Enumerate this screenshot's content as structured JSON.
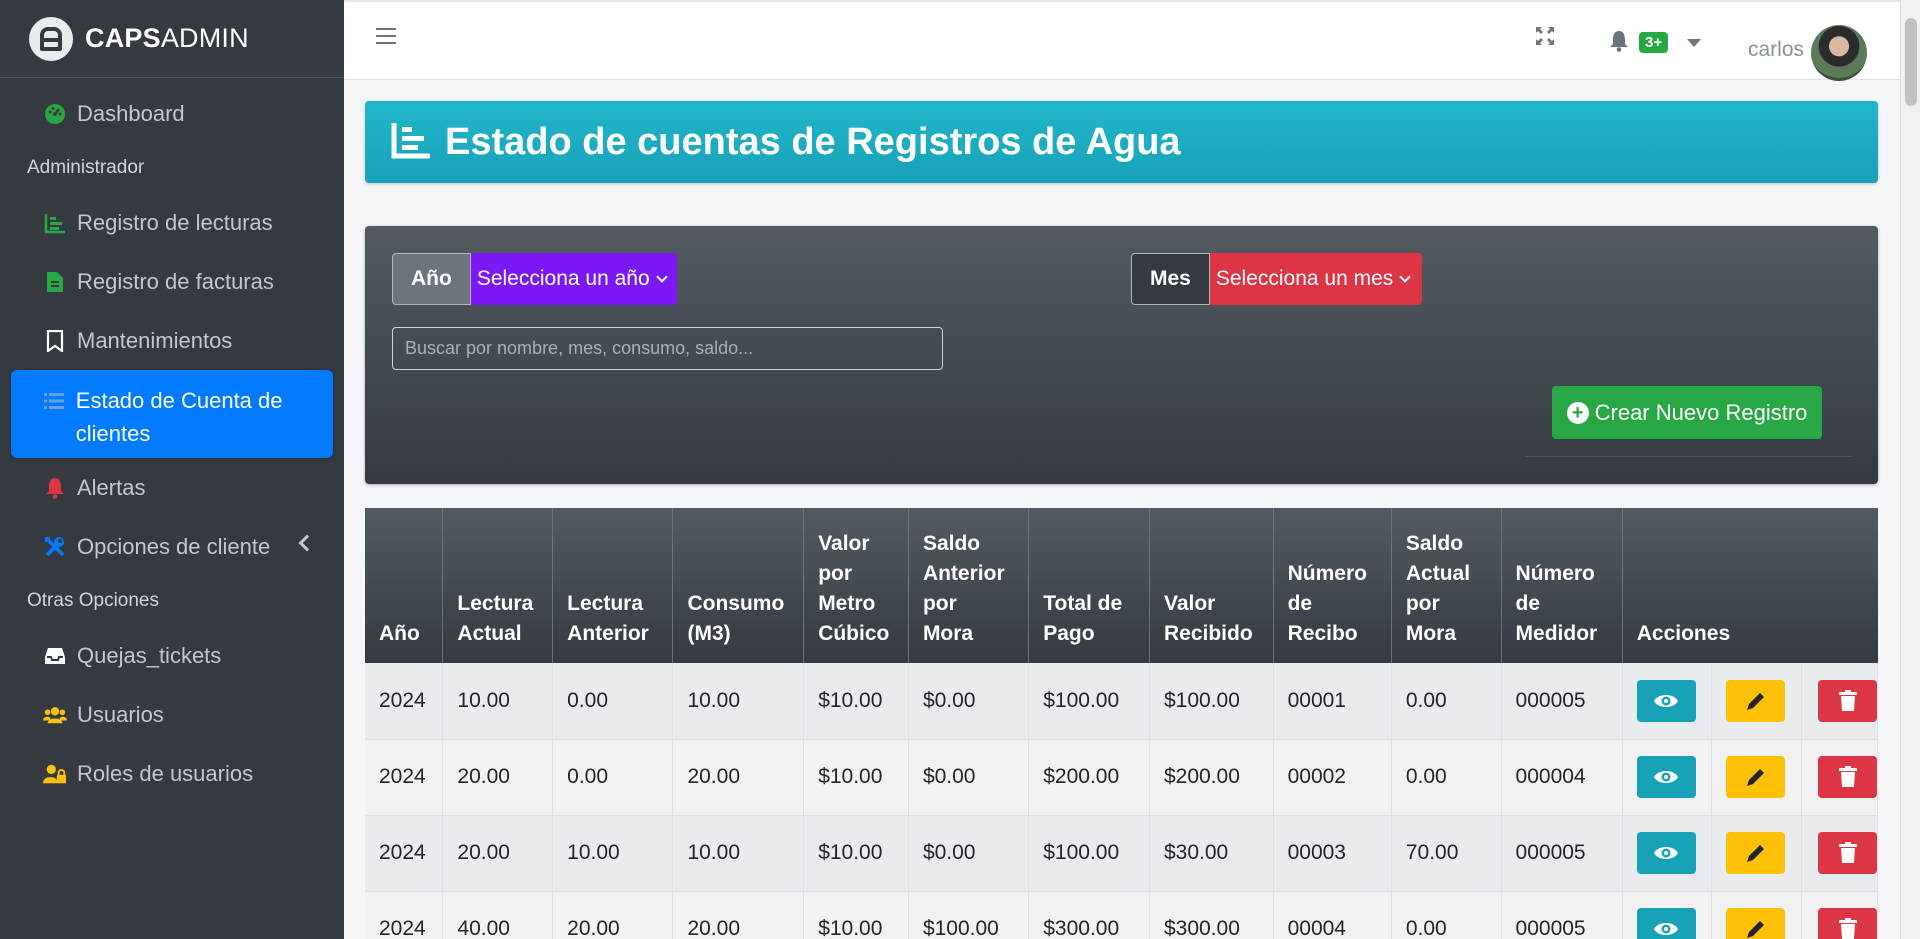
{
  "brand": {
    "bold": "CAPS",
    "rest": "ADMIN"
  },
  "sidebar": {
    "items": [
      {
        "label": "Dashboard",
        "icon": "dashboard-icon",
        "color": "#28a745"
      },
      {
        "header": "Administrador"
      },
      {
        "label": "Registro de lecturas",
        "icon": "chart-icon",
        "color": "#28a745"
      },
      {
        "label": "Registro de facturas",
        "icon": "file-icon",
        "color": "#28a745"
      },
      {
        "label": "Mantenimientos",
        "icon": "bookmark-icon",
        "color": "#ffffff"
      },
      {
        "label": "Estado de Cuenta de clientes",
        "icon": "list-icon",
        "color": "#6c9fd6",
        "active": true
      },
      {
        "label": "Alertas",
        "icon": "bell-icon",
        "color": "#dc3545"
      },
      {
        "label": "Opciones de cliente",
        "icon": "tools-icon",
        "color": "#007bff"
      },
      {
        "header": "Otras Opciones"
      },
      {
        "label": "Quejas_tickets",
        "icon": "inbox-icon",
        "color": "#ffffff"
      },
      {
        "label": "Usuarios",
        "icon": "users-icon",
        "color": "#ffc107"
      },
      {
        "label": "Roles de usuarios",
        "icon": "user-lock-icon",
        "color": "#ffc107"
      }
    ]
  },
  "topbar": {
    "notification_count": "3+",
    "username": "carlos"
  },
  "page": {
    "title": "Estado de cuentas de Registros de Agua"
  },
  "filters": {
    "year_label": "Año",
    "year_select": "Selecciona un año",
    "year_color": "#7b18f5",
    "month_label": "Mes",
    "month_select": "Selecciona un mes",
    "month_color": "#dc3545",
    "search_placeholder": "Buscar por nombre, mes, consumo, saldo...",
    "create_button": "Crear Nuevo Registro"
  },
  "table": {
    "headers": [
      "Año",
      "Lectura Actual",
      "Lectura Anterior",
      "Consumo (M3)",
      "Valor por Metro Cúbico",
      "Saldo Anterior por Mora",
      "Total de Pago",
      "Valor Recibido",
      "Número de Recibo",
      "Saldo Actual por Mora",
      "Número de Medidor",
      "Acciones"
    ],
    "rows": [
      [
        "2024",
        "10.00",
        "0.00",
        "10.00",
        "$10.00",
        "$0.00",
        "$100.00",
        "$100.00",
        "00001",
        "0.00",
        "000005"
      ],
      [
        "2024",
        "20.00",
        "0.00",
        "20.00",
        "$10.00",
        "$0.00",
        "$200.00",
        "$200.00",
        "00002",
        "0.00",
        "000004"
      ],
      [
        "2024",
        "20.00",
        "10.00",
        "10.00",
        "$10.00",
        "$0.00",
        "$100.00",
        "$30.00",
        "00003",
        "70.00",
        "000005"
      ],
      [
        "2024",
        "40.00",
        "20.00",
        "20.00",
        "$10.00",
        "$100.00",
        "$300.00",
        "$300.00",
        "00004",
        "0.00",
        "000005"
      ]
    ]
  }
}
